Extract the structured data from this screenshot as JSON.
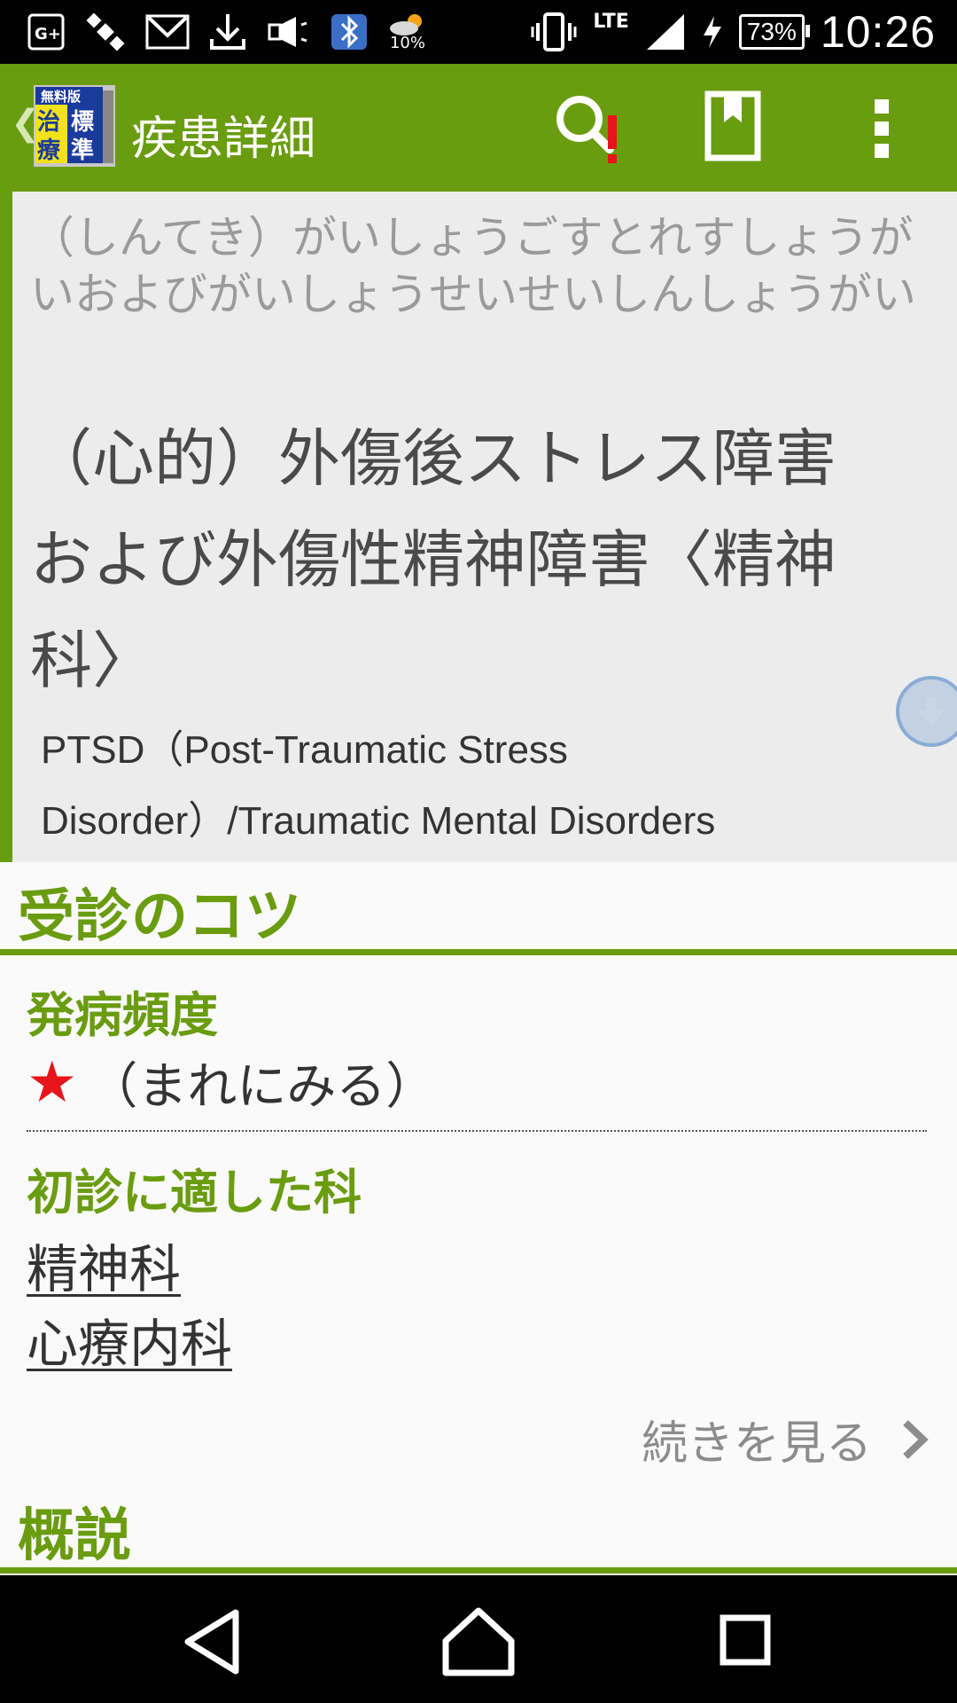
{
  "status_bar": {
    "weather_pct": "10%",
    "network": "LTE",
    "battery": "73%",
    "time": "10:26"
  },
  "app_bar": {
    "logo_texts": [
      "無料版",
      "治",
      "療",
      "標",
      "準"
    ],
    "title": "疾患詳細"
  },
  "disease": {
    "reading": "（しんてき）がいしょうごすとれすしょうがいおよびがいしょうせいせいしんしょうがい",
    "name_line1": "（心的）外傷後ストレス障害",
    "name_line2": "および外傷性精神障害〈精神",
    "name_line3": "科〉",
    "english_line1": "PTSD（Post-Traumatic Stress",
    "english_line2": "Disorder）/Traumatic Mental Disorders"
  },
  "consult_tips": {
    "heading": "受診のコツ",
    "frequency_label": "発病頻度",
    "frequency_star": "★",
    "frequency_value": "（まれにみる）",
    "departments_label": "初診に適した科",
    "departments": [
      "精神科",
      "心療内科"
    ],
    "see_more": "続きを見る"
  },
  "overview": {
    "heading": "概説"
  }
}
